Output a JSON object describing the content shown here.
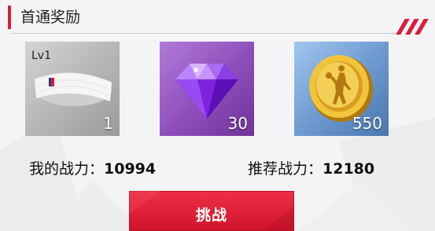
{
  "header": {
    "title": "首通奖励"
  },
  "rewards": [
    {
      "icon": "headband-icon",
      "level": "Lv1",
      "count": "1",
      "bg": "gray"
    },
    {
      "icon": "purple-gem-icon",
      "count": "30",
      "bg": "purple"
    },
    {
      "icon": "gold-coin-icon",
      "count": "550",
      "bg": "blue"
    }
  ],
  "power": {
    "mine_label": "我的战力：",
    "mine_value": "10994",
    "recommended_label": "推荐战力：",
    "recommended_value": "12180"
  },
  "challenge_button": {
    "label": "挑战"
  },
  "colors": {
    "accent": "#d81e3a",
    "background": "#f4f4f6",
    "button": "#e0233a"
  }
}
